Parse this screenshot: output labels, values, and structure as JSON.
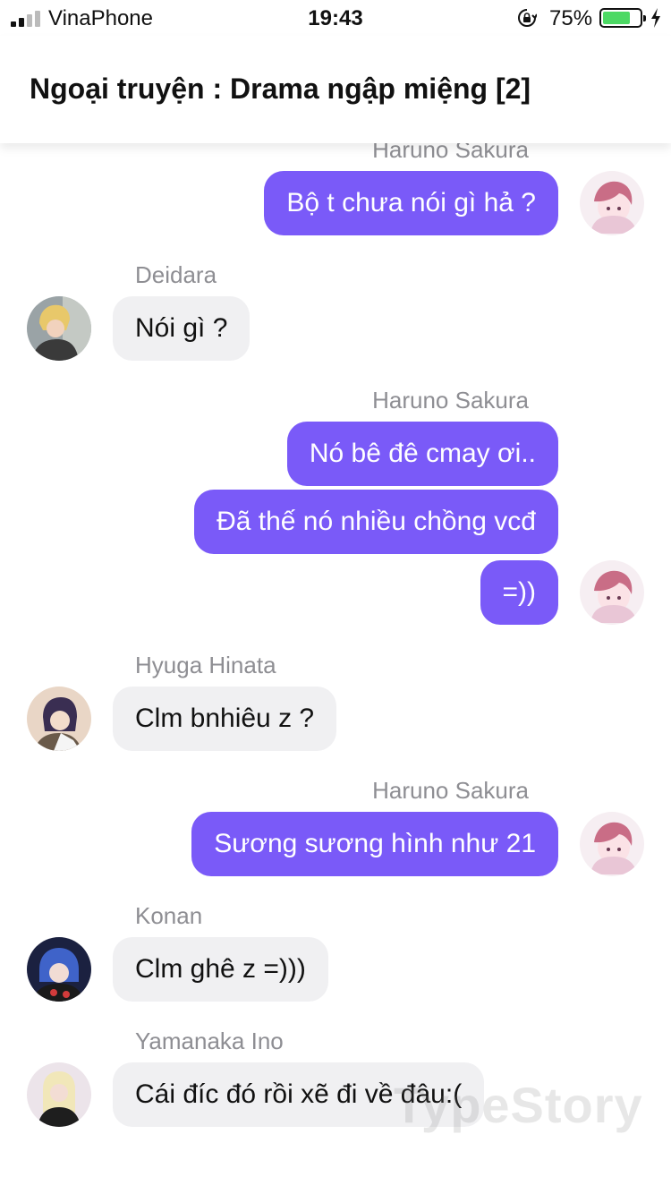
{
  "status_bar": {
    "carrier": "VinaPhone",
    "time": "19:43",
    "battery_percent": "75%",
    "battery_level": 0.75,
    "icons": [
      "signal-icon",
      "rotation-lock-icon",
      "battery-icon",
      "charging-bolt-icon"
    ]
  },
  "header": {
    "title": "Ngoại truyện : Drama ngập miệng [2]"
  },
  "messages": [
    {
      "sender": "Haruno Sakura",
      "text": "Bộ t chưa nói gì hả ?"
    },
    {
      "sender": "Deidara",
      "text": "Nói gì ?"
    },
    {
      "sender": "Haruno Sakura",
      "texts": [
        "Nó bê đê cmay ơi..",
        "Đã thế nó nhiều chồng vcđ",
        "=))"
      ]
    },
    {
      "sender": "Hyuga Hinata",
      "text": "Clm bnhiêu z ?"
    },
    {
      "sender": "Haruno Sakura",
      "text": "Sương sương hình như 21"
    },
    {
      "sender": "Konan",
      "text": "Clm ghê z =)))"
    },
    {
      "sender": "Yamanaka Ino",
      "text": "Cái đíc đó rồi xẽ đi về đâu:("
    }
  ],
  "watermark": "TypeStory",
  "colors": {
    "my_bubble": "#7a5af8",
    "their_bubble": "#f0f0f2",
    "sender_name": "#8e8e93",
    "battery_fill": "#4cd964"
  }
}
